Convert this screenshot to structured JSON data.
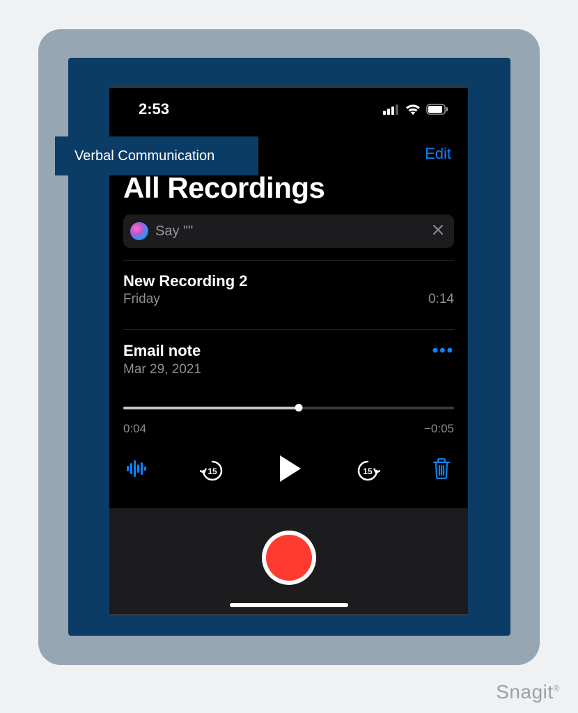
{
  "callout": {
    "label": "Verbal Communication"
  },
  "statusBar": {
    "time": "2:53"
  },
  "nav": {
    "edit": "Edit"
  },
  "header": {
    "title": "All Recordings"
  },
  "search": {
    "hint": "Say \"\""
  },
  "recordings": [
    {
      "title": "New Recording 2",
      "date": "Friday",
      "duration": "0:14"
    },
    {
      "title": "Email note",
      "date": "Mar 29, 2021"
    }
  ],
  "player": {
    "elapsed": "0:04",
    "remaining": "−0:05",
    "skipSeconds": "15"
  },
  "watermark": "Snagit",
  "colors": {
    "accentBlue": "#0a84ff",
    "recordRed": "#ff3b30",
    "frameBlue": "#0b3c66"
  }
}
